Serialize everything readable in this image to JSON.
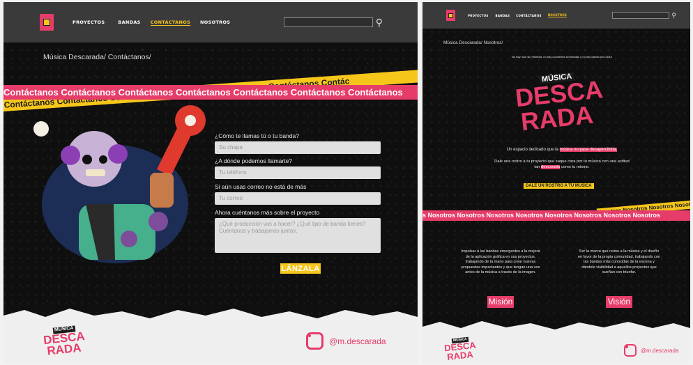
{
  "left": {
    "nav": {
      "items": [
        "PROYECTOS",
        "BANDAS",
        "CONTÁCTANOS",
        "NOSOTROS"
      ],
      "active_index": 2
    },
    "breadcrumb": "Música Descarada/ Contáctanos/",
    "band_pink": "Contáctanos Contáctanos Contáctanos Contáctanos Contáctanos Contáctanos Contáctanos",
    "band_yellow": "s Contáctanos Contáctanos Contáctanos Contáctanos Contáctanos Contáctanos Contác",
    "form": {
      "name_label": "¿Cómo te llamas tú o tu banda?",
      "name_placeholder": "Su chapa",
      "phone_label": "¿A dónde podemos llamarte?",
      "phone_placeholder": "Tu teléfono",
      "email_label": "Si aún usas correo no está de más",
      "email_placeholder": "Tu correo",
      "project_label": "Ahora cuéntanos más sobre el proyecto",
      "project_placeholder": "¿Qué producción vas a hacer? ¿Qué tipo de banda tienes? Cuéntanos y trabajamos juntos.",
      "submit": "LÁNZALA"
    },
    "footer": {
      "instagram_handle": "@m.descarada",
      "logo_top": "MÚSICA",
      "logo_mid": "DESCA",
      "logo_bot": "RADA"
    }
  },
  "right": {
    "nav": {
      "items": [
        "PROYECTOS",
        "BANDAS",
        "CONTÁCTANOS",
        "NOSOTROS"
      ],
      "active_index": 3
    },
    "breadcrumb": "Música Descarada/ Nosotros/",
    "intro": "No hay rock sin rebeldía, no hay conciertos sin bandas y no hay banda sin CARA",
    "logo_top": "MÚSICA",
    "logo_mid": "DESCA",
    "logo_bot": "RADA",
    "tagline_pre": "Un espacio dedicado que la",
    "tagline_hl": "música no pase desapercibida.",
    "text2_pre": "Dale una rostro a tu proyecto que saque cara por tu música con una actitud tan",
    "text2_hl": "descarada",
    "text2_post": "como tu mismo.",
    "cta": "DALE UN ROSTRO A TU MÚSICA",
    "band_pink": "s Nosotros Nosotros Nosotros Nosotros Nosotros Nosotros Nosotros Nosotros",
    "band_yellow": "Nosotros Nosotros Nosotros Nosotros",
    "mision_text": "Impulsar a las bandas emergentes a la mejora de la aplicación gráfica en sus proyectos, trabajando de la mano para crear nuevas propuestas impactantes y que tengan una voz antes de la música a través de la imagen.",
    "vision_text": "Ser la marca que reúne a la música y el diseño en favor de la propia comunidad, trabajando con las bandas más conocidas de la escena y dándole visibilidad a aquellos proyectos que sueñan con triunfar.",
    "mision": "Misión",
    "vision": "Visión",
    "footer": {
      "instagram_handle": "@m.descarada",
      "logo_top": "MÚSICA",
      "logo_mid": "DESCA",
      "logo_bot": "RADA"
    }
  },
  "colors": {
    "pink": "#e63c6a",
    "yellow": "#f6c61b",
    "navbar": "#3a3a3a",
    "bg": "#0f0f0f"
  }
}
